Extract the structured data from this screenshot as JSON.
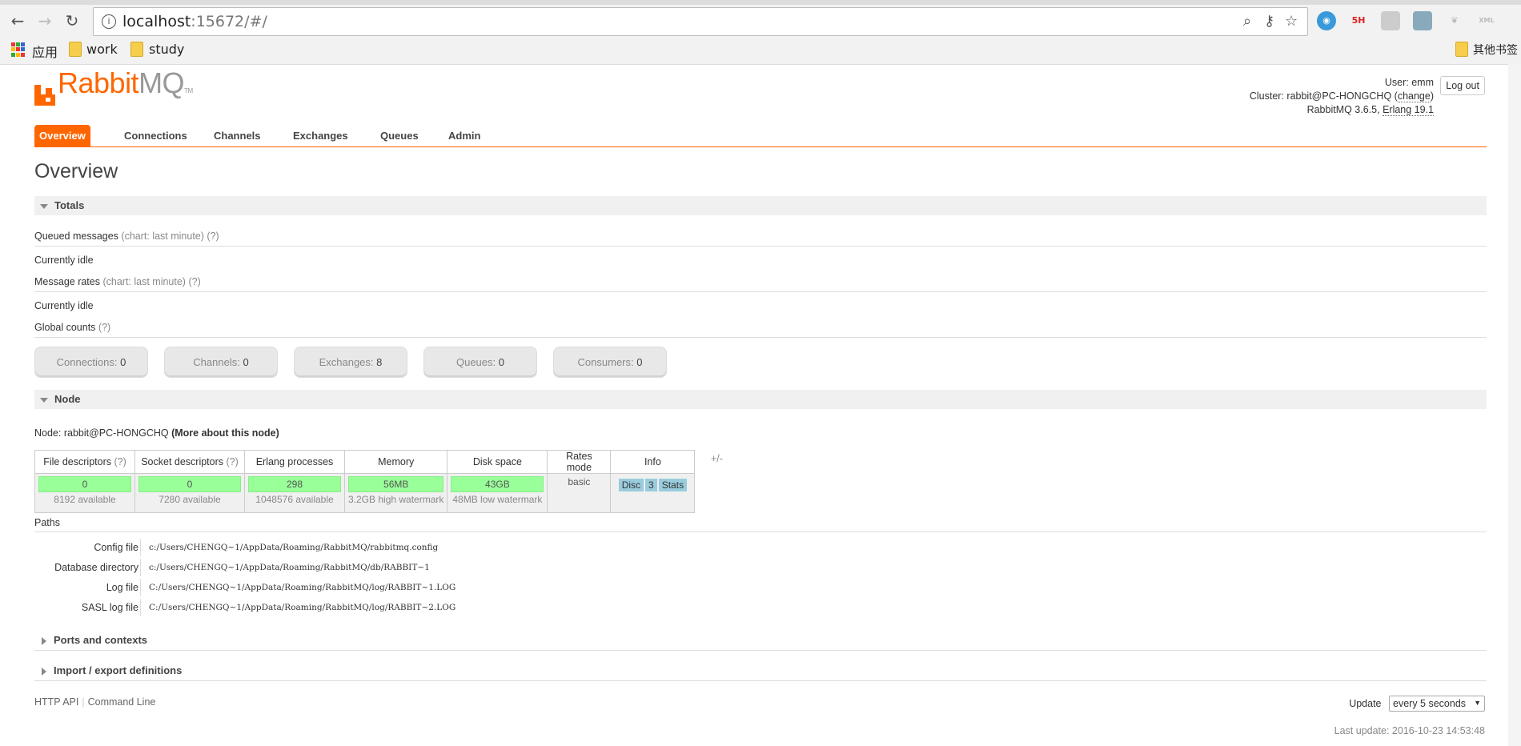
{
  "browser": {
    "url_host": "localhost",
    "url_port": ":15672/#/",
    "bookmarks": [
      "应用",
      "work",
      "study"
    ],
    "other_bookmarks": "其他书签",
    "ext_5h": "5H"
  },
  "header": {
    "logo_rabbit": "Rabbit",
    "logo_mq": "MQ",
    "logo_tm": "TM",
    "user_label": "User:",
    "user": "emm",
    "cluster_label": "Cluster:",
    "cluster": "rabbit@PC-HONGCHQ",
    "change": "change",
    "version": "RabbitMQ 3.6.5,",
    "erlang": "Erlang 19.1",
    "logout": "Log out"
  },
  "nav": {
    "tabs": [
      "Overview",
      "Connections",
      "Channels",
      "Exchanges",
      "Queues",
      "Admin"
    ]
  },
  "page_title": "Overview",
  "totals": {
    "heading": "Totals",
    "queued_label": "Queued messages",
    "queued_chart": "(chart: last minute)",
    "help": "(?)",
    "idle1": "Currently idle",
    "rates_label": "Message rates",
    "rates_chart": "(chart: last minute)",
    "idle2": "Currently idle",
    "global_label": "Global counts",
    "counts": [
      {
        "label": "Connections:",
        "value": "0"
      },
      {
        "label": "Channels:",
        "value": "0"
      },
      {
        "label": "Exchanges:",
        "value": "8"
      },
      {
        "label": "Queues:",
        "value": "0"
      },
      {
        "label": "Consumers:",
        "value": "0"
      }
    ]
  },
  "node": {
    "heading": "Node",
    "node_label": "Node: rabbit@PC-HONGCHQ",
    "more": "(More about this node)",
    "columns": [
      "File descriptors",
      "Socket descriptors",
      "Erlang processes",
      "Memory",
      "Disk space",
      "Rates mode",
      "Info"
    ],
    "plusminus": "+/-",
    "file_desc": {
      "value": "0",
      "sub": "8192 available"
    },
    "socket_desc": {
      "value": "0",
      "sub": "7280 available"
    },
    "erlang_proc": {
      "value": "298",
      "sub": "1048576 available"
    },
    "memory": {
      "value": "56MB",
      "sub": "3.2GB high watermark"
    },
    "disk": {
      "value": "43GB",
      "sub": "48MB low watermark"
    },
    "rates_mode": "basic",
    "info": [
      "Disc",
      "3",
      "Stats"
    ]
  },
  "paths": {
    "heading": "Paths",
    "rows": [
      {
        "label": "Config file",
        "value": "c:/Users/CHENGQ~1/AppData/Roaming/RabbitMQ/rabbitmq.config"
      },
      {
        "label": "Database directory",
        "value": "c:/Users/CHENGQ~1/AppData/Roaming/RabbitMQ/db/RABBIT~1"
      },
      {
        "label": "Log file",
        "value": "C:/Users/CHENGQ~1/AppData/Roaming/RabbitMQ/log/RABBIT~1.LOG"
      },
      {
        "label": "SASL log file",
        "value": "C:/Users/CHENGQ~1/AppData/Roaming/RabbitMQ/log/RABBIT~2.LOG"
      }
    ]
  },
  "sections": {
    "ports": "Ports and contexts",
    "import": "Import / export definitions"
  },
  "footer": {
    "http_api": "HTTP API",
    "cmdline": "Command Line",
    "update_label": "Update",
    "update_value": "every 5 seconds",
    "last_update": "Last update: 2016-10-23 14:53:48"
  }
}
